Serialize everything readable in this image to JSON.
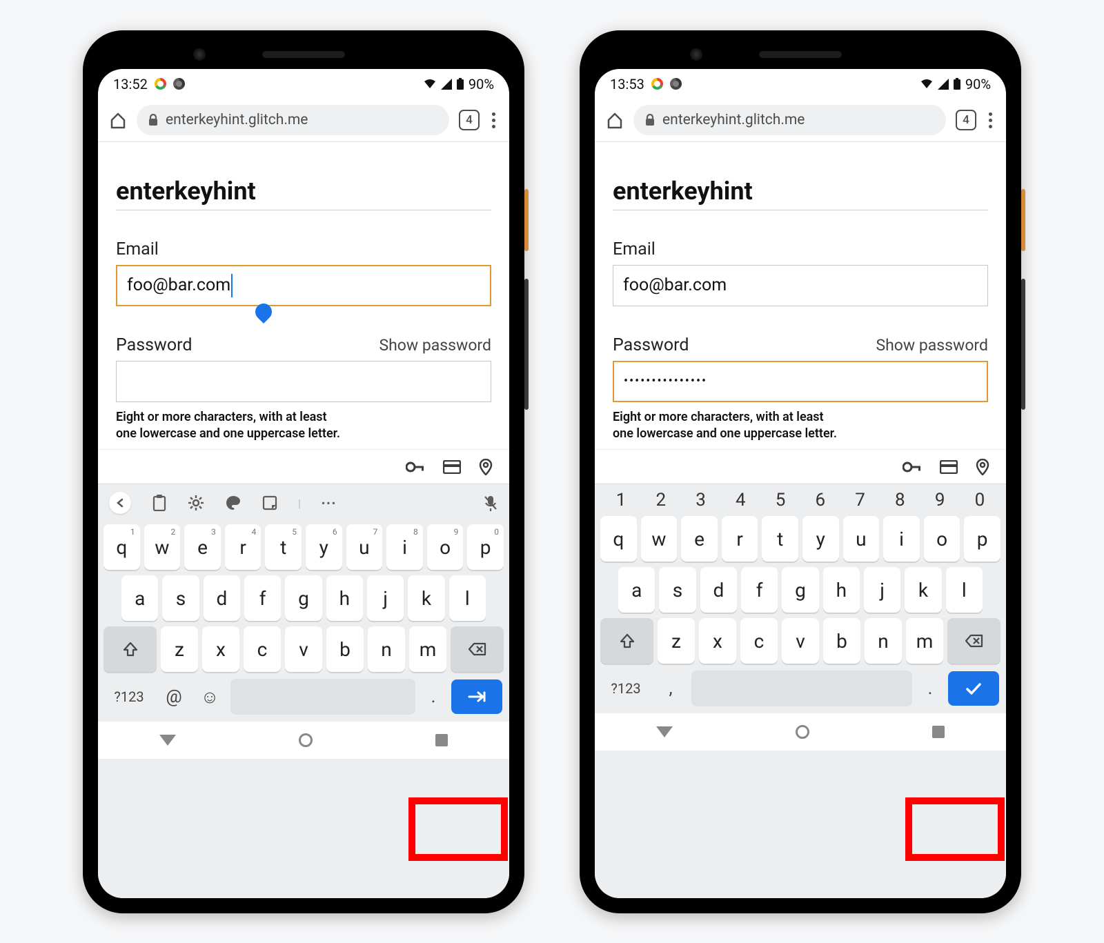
{
  "phones": [
    {
      "status": {
        "time": "13:52",
        "battery": "90%"
      },
      "browser": {
        "url": "enterkeyhint.glitch.me",
        "tab_count": "4"
      },
      "page": {
        "title": "enterkeyhint",
        "email_label": "Email",
        "email_value": "foo@bar.com",
        "email_focused": true,
        "show_caret": true,
        "password_label": "Password",
        "show_password": "Show password",
        "password_value": "",
        "password_focused": false,
        "helper_l1": "Eight or more characters, with at least",
        "helper_l2": "one lowercase and one uppercase letter."
      },
      "keyboard": {
        "show_toolbar": true,
        "show_number_row": false,
        "sym_label": "?123",
        "extra_glyph": "@",
        "emoji": "☺",
        "period": ".",
        "enter_icon": "next"
      }
    },
    {
      "status": {
        "time": "13:53",
        "battery": "90%"
      },
      "browser": {
        "url": "enterkeyhint.glitch.me",
        "tab_count": "4"
      },
      "page": {
        "title": "enterkeyhint",
        "email_label": "Email",
        "email_value": "foo@bar.com",
        "email_focused": false,
        "show_caret": false,
        "password_label": "Password",
        "show_password": "Show password",
        "password_value": "•••••••••••••••",
        "password_focused": true,
        "helper_l1": "Eight or more characters, with at least",
        "helper_l2": "one lowercase and one uppercase letter."
      },
      "keyboard": {
        "show_toolbar": false,
        "show_number_row": true,
        "sym_label": "?123",
        "extra_glyph": ",",
        "emoji": "",
        "period": ".",
        "enter_icon": "done"
      }
    }
  ],
  "keys": {
    "numbers": [
      "1",
      "2",
      "3",
      "4",
      "5",
      "6",
      "7",
      "8",
      "9",
      "0"
    ],
    "row1": [
      "q",
      "w",
      "e",
      "r",
      "t",
      "y",
      "u",
      "i",
      "o",
      "p"
    ],
    "row1_sup": [
      "1",
      "2",
      "3",
      "4",
      "5",
      "6",
      "7",
      "8",
      "9",
      "0"
    ],
    "row2": [
      "a",
      "s",
      "d",
      "f",
      "g",
      "h",
      "j",
      "k",
      "l"
    ],
    "row3": [
      "z",
      "x",
      "c",
      "v",
      "b",
      "n",
      "m"
    ]
  }
}
